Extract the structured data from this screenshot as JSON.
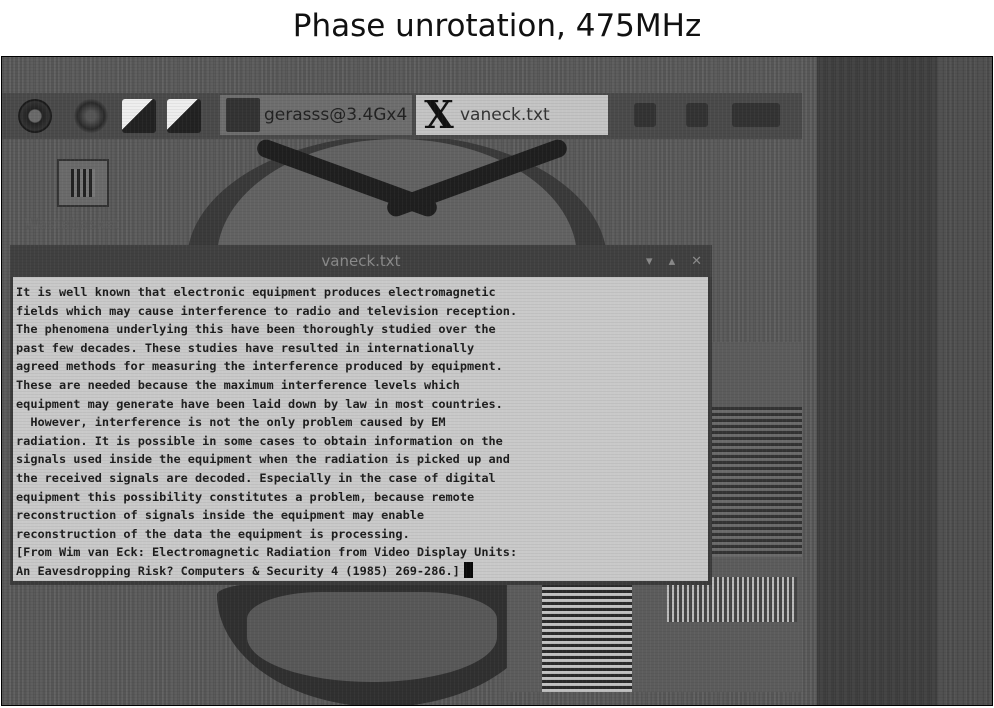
{
  "figure": {
    "title": "Phase unrotation, 475MHz"
  },
  "taskbar": {
    "tasks": [
      {
        "label": "gerasss@3.4Gx4"
      },
      {
        "label": "vaneck.txt",
        "active": true
      }
    ]
  },
  "desktop": {
    "icon_label": "Wastebasket"
  },
  "editor": {
    "title": "vaneck.txt",
    "controls": {
      "minimize": "▾",
      "maximize": "▴",
      "close": "✕"
    },
    "lines": [
      "It is well known that electronic equipment produces electromagnetic",
      "fields which may cause interference to radio and television reception.",
      "The phenomena underlying this have been thoroughly studied over the",
      "past few decades. These studies have resulted in internationally",
      "agreed methods for measuring the interference produced by equipment.",
      "These are needed because the maximum interference levels which",
      "equipment may generate have been laid down by law in most countries.",
      "  However, interference is not the only problem caused by EM",
      "radiation. It is possible in some cases to obtain information on the",
      "signals used inside the equipment when the radiation is picked up and",
      "the received signals are decoded. Especially in the case of digital",
      "equipment this possibility constitutes a problem, because remote",
      "reconstruction of signals inside the equipment may enable",
      "reconstruction of the data the equipment is processing.",
      "[From Wim van Eck: Electromagnetic Radiation from Video Display Units:",
      "An Eavesdropping Risk? Computers & Security 4 (1985) 269-286.]"
    ]
  }
}
